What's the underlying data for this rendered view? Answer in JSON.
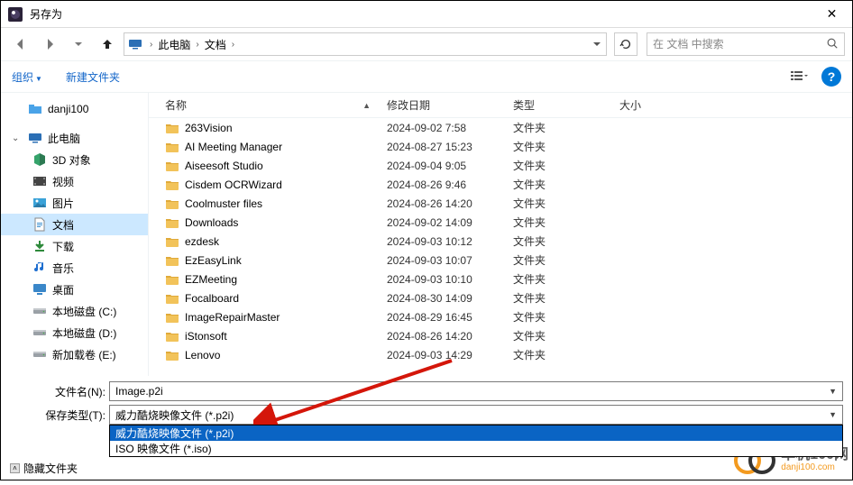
{
  "title": "另存为",
  "breadcrumb": {
    "root": "此电脑",
    "folder": "文档"
  },
  "search": {
    "placeholder": "在 文档 中搜索"
  },
  "toolbar": {
    "organize": "组织",
    "newfolder": "新建文件夹",
    "help_char": "?"
  },
  "sidebar": {
    "top": "danji100",
    "thispc": "此电脑",
    "items": [
      {
        "label": "3D 对象",
        "icon": "3d"
      },
      {
        "label": "视频",
        "icon": "video"
      },
      {
        "label": "图片",
        "icon": "picture"
      },
      {
        "label": "文档",
        "icon": "doc",
        "selected": true
      },
      {
        "label": "下载",
        "icon": "download"
      },
      {
        "label": "音乐",
        "icon": "music"
      },
      {
        "label": "桌面",
        "icon": "desktop"
      },
      {
        "label": "本地磁盘 (C:)",
        "icon": "disk"
      },
      {
        "label": "本地磁盘 (D:)",
        "icon": "disk"
      },
      {
        "label": "新加载卷 (E:)",
        "icon": "disk"
      }
    ]
  },
  "columns": {
    "name": "名称",
    "date": "修改日期",
    "type": "类型",
    "size": "大小"
  },
  "folder_type": "文件夹",
  "files": [
    {
      "name": "263Vision",
      "date": "2024-09-02 7:58"
    },
    {
      "name": "AI Meeting Manager",
      "date": "2024-08-27 15:23"
    },
    {
      "name": "Aiseesoft Studio",
      "date": "2024-09-04 9:05"
    },
    {
      "name": "Cisdem OCRWizard",
      "date": "2024-08-26 9:46"
    },
    {
      "name": "Coolmuster files",
      "date": "2024-08-26 14:20"
    },
    {
      "name": "Downloads",
      "date": "2024-09-02 14:09"
    },
    {
      "name": "ezdesk",
      "date": "2024-09-03 10:12"
    },
    {
      "name": "EzEasyLink",
      "date": "2024-09-03 10:07"
    },
    {
      "name": "EZMeeting",
      "date": "2024-09-03 10:10"
    },
    {
      "name": "Focalboard",
      "date": "2024-08-30 14:09"
    },
    {
      "name": "ImageRepairMaster",
      "date": "2024-08-29 16:45"
    },
    {
      "name": "iStonsoft",
      "date": "2024-08-26 14:20"
    },
    {
      "name": "Lenovo",
      "date": "2024-09-03 14:29"
    }
  ],
  "filename_label": "文件名(N):",
  "filename_value": "Image.p2i",
  "filetype_label": "保存类型(T):",
  "filetype_value": "威力酷烧映像文件 (*.p2i)",
  "filetype_options": [
    "威力酷烧映像文件 (*.p2i)",
    "ISO 映像文件 (*.iso)"
  ],
  "hide_folders": "隐藏文件夹",
  "watermark": {
    "cn": "单机100网",
    "url": "danji100.com"
  }
}
